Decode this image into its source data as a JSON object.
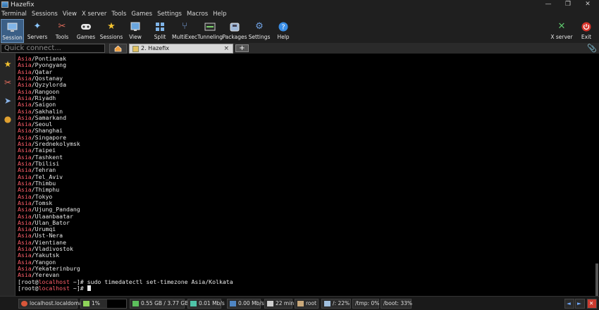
{
  "window": {
    "title": "Hazefix"
  },
  "menu": [
    "Terminal",
    "Sessions",
    "View",
    "X server",
    "Tools",
    "Games",
    "Settings",
    "Macros",
    "Help"
  ],
  "toolbar": {
    "session": "Session",
    "servers": "Servers",
    "tools": "Tools",
    "games": "Games",
    "sessions": "Sessions",
    "view": "View",
    "split": "Split",
    "multiexec": "MultiExec",
    "tunneling": "Tunneling",
    "packages": "Packages",
    "settings": "Settings",
    "help": "Help",
    "xserver": "X server",
    "exit": "Exit"
  },
  "quick_connect": {
    "placeholder": "Quick connect..."
  },
  "tabs": {
    "active_label": "2. Hazefix",
    "close": "×",
    "add": "+"
  },
  "terminal": {
    "region_prefix": "Asia",
    "zones": [
      "Pontianak",
      "Pyongyang",
      "Qatar",
      "Qostanay",
      "Qyzylorda",
      "Rangoon",
      "Riyadh",
      "Saigon",
      "Sakhalin",
      "Samarkand",
      "Seoul",
      "Shanghai",
      "Singapore",
      "Srednekolymsk",
      "Taipei",
      "Tashkent",
      "Tbilisi",
      "Tehran",
      "Tel_Aviv",
      "Thimbu",
      "Thimphu",
      "Tokyo",
      "Tomsk",
      "Ujung_Pandang",
      "Ulaanbaatar",
      "Ulan_Bator",
      "Urumqi",
      "Ust-Nera",
      "Vientiane",
      "Vladivostok",
      "Yakutsk",
      "Yangon",
      "Yekaterinburg",
      "Yerevan"
    ],
    "prompt_user": "root",
    "prompt_at": "@",
    "prompt_host": "localhost",
    "prompt_path": " ~",
    "command": "sudo timedatectl set-timezone Asia/Kolkata"
  },
  "status": {
    "host": "localhost.localdomain",
    "cpu": "1%",
    "memory": "0.55 GB / 3.77 GB",
    "upload": "0.01 Mb/s",
    "download": "0.00 Mb/s",
    "uptime": "22 min",
    "user": "root",
    "disk_root": "/: 22%",
    "disk_tmp": "/tmp: 0%",
    "disk_boot": "/boot: 33%"
  },
  "colors": {
    "accent": "#3b5f86",
    "region_red": "#ff5f6b",
    "terminal_bg": "#000000"
  }
}
